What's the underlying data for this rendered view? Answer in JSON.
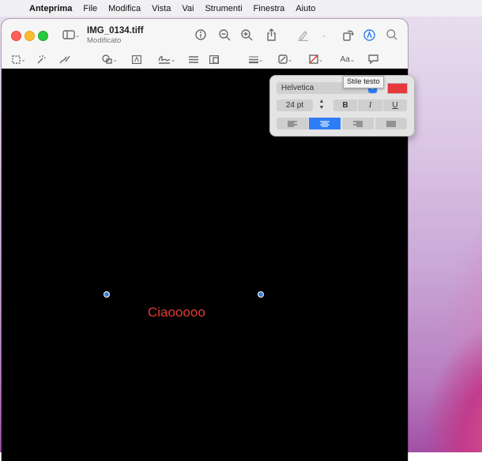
{
  "menubar": {
    "app_name": "Anteprima",
    "items": [
      "File",
      "Modifica",
      "Vista",
      "Vai",
      "Strumenti",
      "Finestra",
      "Aiuto"
    ]
  },
  "window": {
    "title": "IMG_0134.tiff",
    "subtitle": "Modificato"
  },
  "canvas": {
    "annotation_text": "Ciaooooo",
    "annotation_color": "#e33a32"
  },
  "text_style_popover": {
    "font": "Helvetica",
    "size": "24 pt",
    "bold_label": "B",
    "italic_label": "I",
    "underline_label": "U",
    "color": "#e8383c",
    "selected_alignment": "center"
  },
  "tooltip": "Stile testo"
}
